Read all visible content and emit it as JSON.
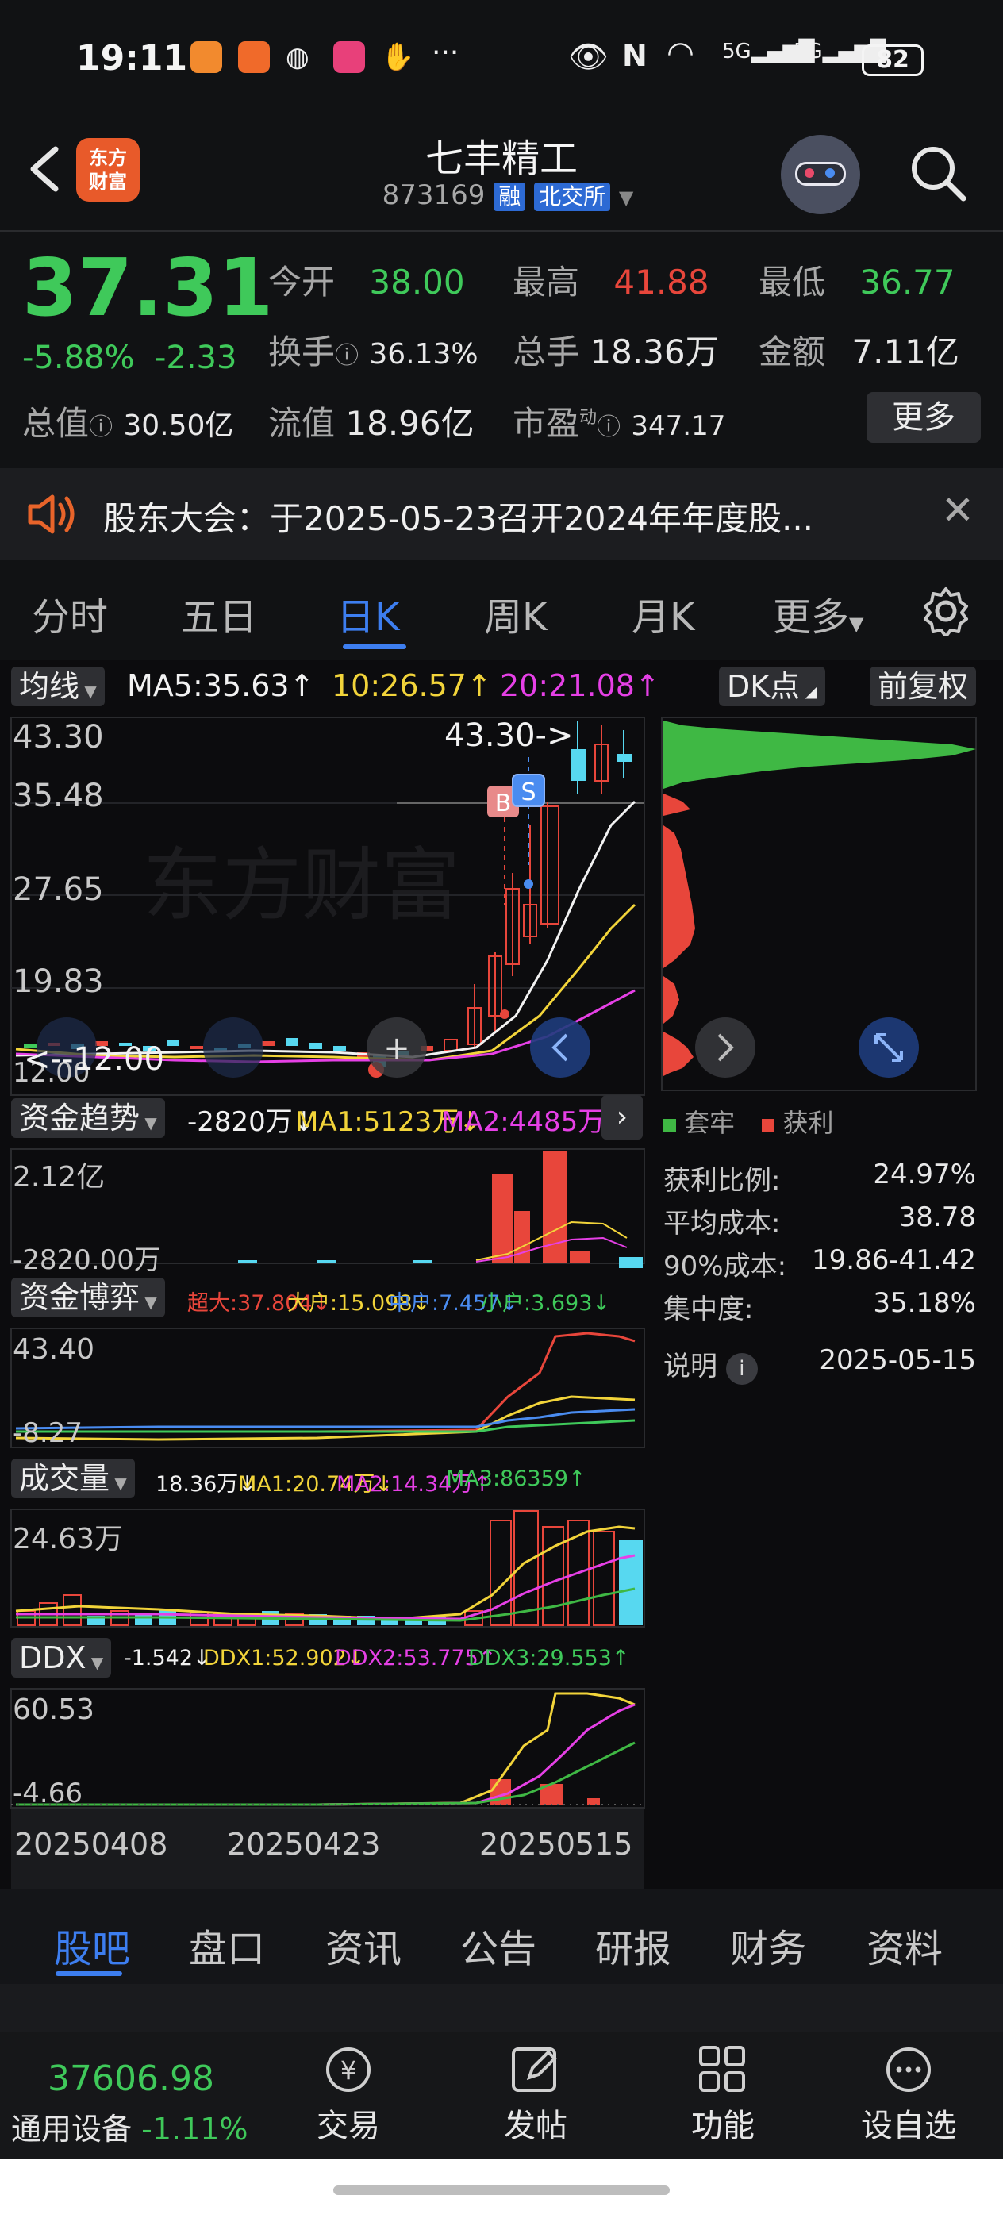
{
  "status_bar": {
    "time": "19:11",
    "network": "5G 5G",
    "battery": "82"
  },
  "header": {
    "logo_text": "东方\n财富",
    "title": "七丰精工",
    "code": "873169",
    "tag_margin": "融",
    "tag_exchange": "北交所"
  },
  "quote": {
    "price": "37.31",
    "change_pct": "-5.88%",
    "change_amt": "-2.33",
    "open_label": "今开",
    "open": "38.00",
    "high_label": "最高",
    "high": "41.88",
    "low_label": "最低",
    "low": "36.77",
    "turnover_label": "换手",
    "turnover": "36.13%",
    "volume_label": "总手",
    "volume": "18.36万",
    "amount_label": "金额",
    "amount": "7.11亿",
    "mktcap_label": "总值",
    "mktcap": "30.50亿",
    "float_label": "流值",
    "float_cap": "18.96亿",
    "pe_label": "市盈",
    "pe_sup": "动",
    "pe": "347.17",
    "more": "更多"
  },
  "notice": {
    "text": "股东大会：于2025-05-23召开2024年年度股..."
  },
  "tabs": [
    "分时",
    "五日",
    "日K",
    "周K",
    "月K",
    "更多"
  ],
  "kline": {
    "ma_label": "均线",
    "ma5": "MA5:35.63↑",
    "ma10": "10:26.57↑",
    "ma20": "20:21.08↑",
    "dk": "DK点",
    "adjust": "前复权",
    "y_ticks": [
      "43.30",
      "35.48",
      "27.65",
      "19.83",
      "12.00"
    ],
    "max_marker": "43.30->",
    "min_marker": "<--12.00",
    "buy_tag": "B",
    "sell_tag": "S"
  },
  "fund_trend": {
    "label": "资金趋势",
    "value": "-2820万↓",
    "ma1": "MA1:5123万↓",
    "ma2": "MA2:4485万↓",
    "y_top": "2.12亿",
    "y_bottom": "-2820.00万"
  },
  "fund_game": {
    "label": "资金博弈",
    "super": "超大:37.804↓",
    "large": "大户:15.098↓",
    "mid": "中户:7.457↓",
    "small": "小户:3.693↓",
    "y_top": "43.40",
    "y_bottom": "-8.27"
  },
  "volume": {
    "label": "成交量",
    "value": "18.36万↓",
    "ma1": "MA1:20.74万↓",
    "ma2": "MA2:14.34万↑",
    "ma3": "MA3:86359↑",
    "y_top": "24.63万"
  },
  "ddx": {
    "label": "DDX",
    "value": "-1.542↓",
    "ddx1": "DDX1:52.902↓",
    "ddx2": "DDX2:53.775↑",
    "ddx3": "DDX3:29.553↑",
    "y_top": "60.53",
    "y_bottom": "-4.66"
  },
  "dates": [
    "20250408",
    "20250423",
    "20250515"
  ],
  "chips": {
    "legend_trapped": "套牢",
    "legend_profit": "获利",
    "profit_ratio_label": "获利比例:",
    "profit_ratio": "24.97%",
    "avg_cost_label": "平均成本:",
    "avg_cost": "38.78",
    "cost90_label": "90%成本:",
    "cost90": "19.86-41.42",
    "concentration_label": "集中度:",
    "concentration": "35.18%",
    "note_label": "说明",
    "date": "2025-05-15"
  },
  "bottom_tabs": [
    "股吧",
    "盘口",
    "资讯",
    "公告",
    "研报",
    "财务",
    "资料"
  ],
  "nav": {
    "index_value": "37606.98",
    "index_name": "通用设备",
    "index_change": "-1.11%",
    "trade": "交易",
    "post": "发帖",
    "function": "功能",
    "watchlist": "设自选"
  },
  "colors": {
    "up": "#e8463b",
    "down": "#3fc95a",
    "accent": "#3d7ef0",
    "ma5": "#f2f2f2",
    "ma10": "#f2d43a",
    "ma20": "#e640e6"
  }
}
